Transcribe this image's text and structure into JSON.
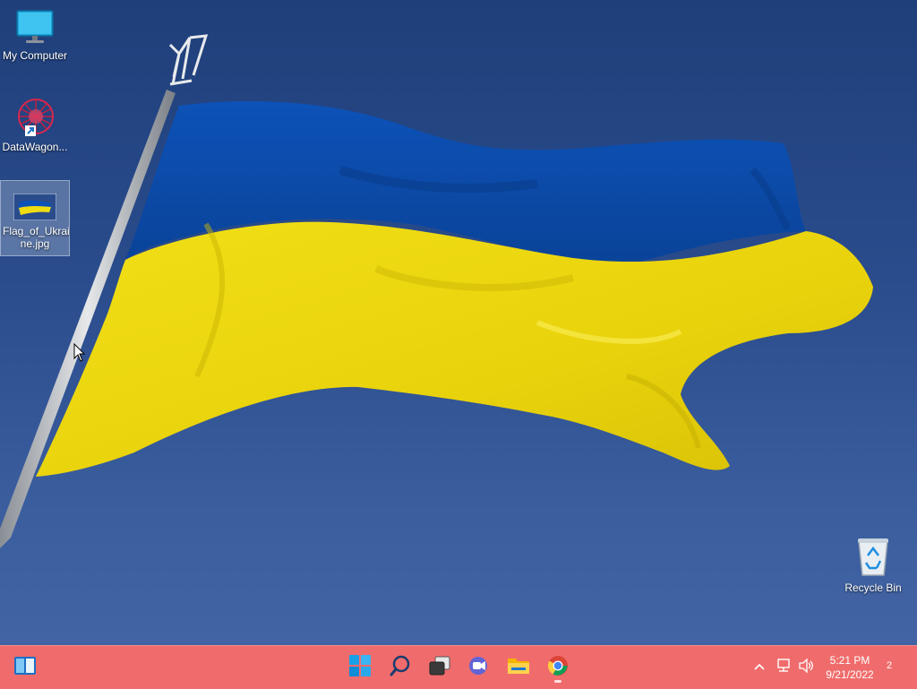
{
  "desktop": {
    "icons": [
      {
        "label": "My Computer",
        "icon": "monitor-icon"
      },
      {
        "label": "DataWagon...",
        "icon": "datawagon-icon"
      },
      {
        "label": "Flag_of_Ukraine.jpg",
        "label_line1": "Flag_of_Ukrai",
        "label_line2": "ne.jpg",
        "icon": "image-thumbnail-icon"
      },
      {
        "label": "Recycle Bin",
        "icon": "recycle-bin-icon"
      }
    ],
    "wallpaper": {
      "subject": "flag",
      "colors": {
        "blue": "#0b4fb4",
        "yellow": "#f1dc10",
        "sky": "#2a4c8c"
      }
    }
  },
  "taskbar": {
    "color": "#f06c6c",
    "buttons": [
      {
        "name": "widgets",
        "icon": "widgets-icon"
      },
      {
        "name": "start",
        "icon": "windows-start-icon"
      },
      {
        "name": "search",
        "icon": "search-icon"
      },
      {
        "name": "task-view",
        "icon": "task-view-icon"
      },
      {
        "name": "chat",
        "icon": "teams-chat-icon"
      },
      {
        "name": "file-explorer",
        "icon": "folder-icon"
      },
      {
        "name": "chrome",
        "icon": "chrome-icon",
        "running": true
      }
    ],
    "tray": {
      "icons": [
        "chevron-up-icon",
        "network-icon",
        "volume-icon"
      ],
      "time": "5:21 PM",
      "date": "9/21/2022",
      "notification_count": "2"
    }
  }
}
